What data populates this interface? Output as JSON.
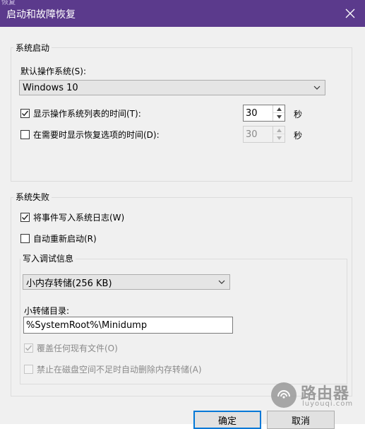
{
  "window": {
    "behind_title": "恢复",
    "title": "启动和故障恢复",
    "accent": "#5b3a8c"
  },
  "system_startup": {
    "legend": "系统启动",
    "default_os_label": "默认操作系统(S):",
    "default_os_value": "Windows 10",
    "show_os_list": {
      "checked": true,
      "label": "显示操作系统列表的时间(T):",
      "value": "30",
      "unit": "秒"
    },
    "show_recovery": {
      "checked": false,
      "label": "在需要时显示恢复选项的时间(D):",
      "value": "30",
      "unit": "秒"
    }
  },
  "system_failure": {
    "legend": "系统失败",
    "write_event": {
      "checked": true,
      "label": "将事件写入系统日志(W)"
    },
    "auto_restart": {
      "checked": false,
      "label": "自动重新启动(R)"
    },
    "debug_info": {
      "legend": "写入调试信息",
      "dump_type": "小内存转储(256 KB)",
      "dump_dir_label": "小转储目录:",
      "dump_dir_value": "%SystemRoot%\\Minidump",
      "overwrite": {
        "checked": true,
        "label": "覆盖任何现有文件(O)"
      },
      "disable_auto_delete": {
        "checked": false,
        "label": "禁止在磁盘空间不足时自动删除内存转储(A)"
      }
    }
  },
  "buttons": {
    "ok": "确定",
    "cancel": "取消"
  },
  "watermark": {
    "name": "路由器",
    "url": "luyouqi.com"
  }
}
